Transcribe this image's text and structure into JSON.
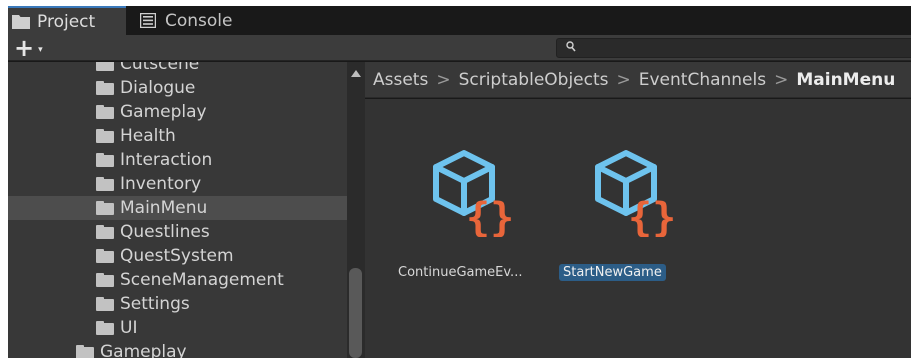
{
  "tabs": [
    {
      "label": "Project",
      "icon": "folder-icon",
      "active": true
    },
    {
      "label": "Console",
      "icon": "console-icon",
      "active": false
    }
  ],
  "toolbar": {
    "create_label": "+",
    "create_caret": "▾",
    "search_value": ""
  },
  "tree": {
    "items": [
      {
        "label": "Cutscene"
      },
      {
        "label": "Dialogue"
      },
      {
        "label": "Gameplay"
      },
      {
        "label": "Health"
      },
      {
        "label": "Interaction"
      },
      {
        "label": "Inventory"
      },
      {
        "label": "MainMenu",
        "selected": true
      },
      {
        "label": "Questlines"
      },
      {
        "label": "QuestSystem"
      },
      {
        "label": "SceneManagement"
      },
      {
        "label": "Settings"
      },
      {
        "label": "UI"
      },
      {
        "label": "Gameplay"
      }
    ]
  },
  "breadcrumb": {
    "parts": [
      "Assets",
      "ScriptableObjects",
      "EventChannels",
      "MainMenu"
    ],
    "separator": ">"
  },
  "assets": [
    {
      "label": "ContinueGameEv...",
      "icon": "scriptable-object-icon",
      "selected": false
    },
    {
      "label": "StartNewGame",
      "icon": "scriptable-object-icon",
      "selected": true
    }
  ],
  "colors": {
    "icon_cube": "#6ec3ee",
    "icon_braces": "#e8653a",
    "selection": "#2c5d87",
    "tab_accent": "#3a79bb"
  }
}
